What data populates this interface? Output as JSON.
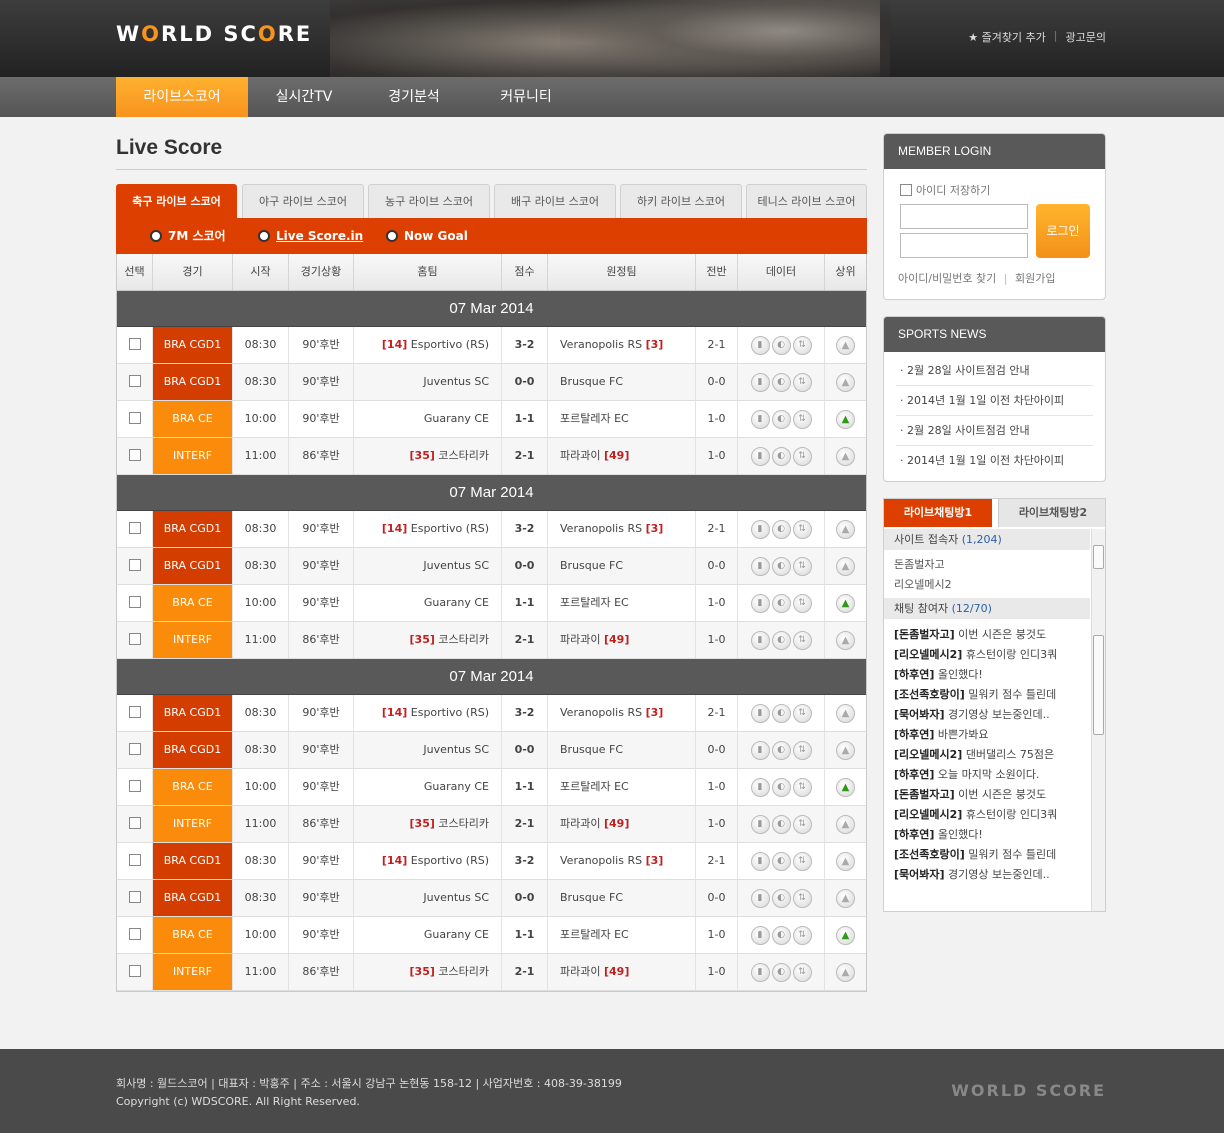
{
  "brand": {
    "logo_part1": "W",
    "logo_o": "O",
    "logo_part2": "RLD SC",
    "logo_o2": "O",
    "logo_part3": "RE"
  },
  "toplinks": {
    "bookmark": "★ 즐겨찾기 추가",
    "sep": "|",
    "ad": "광고문의"
  },
  "gnb": [
    "라이브스코어",
    "실시간TV",
    "경기분석",
    "커뮤니티"
  ],
  "page_title": "Live Score",
  "sport_tabs": [
    "축구 라이브 스코어",
    "야구 라이브 스코어",
    "농구 라이브 스코어",
    "배구 라이브 스코어",
    "하키 라이브 스코어",
    "테니스 라이브 스코어"
  ],
  "sub_links": [
    "7M 스코어",
    "Live Score.in",
    "Now Goal"
  ],
  "columns": [
    "선택",
    "경기",
    "시작",
    "경기상황",
    "홈팀",
    "점수",
    "원정팀",
    "전반",
    "데이터",
    "상위"
  ],
  "groups": [
    {
      "date": "07 Mar 2014",
      "rows": [
        {
          "league": "BRA CGD1",
          "color": "red",
          "start": "08:30",
          "status": "90'후반",
          "home_rank": "[14]",
          "home": "Esportivo (RS)",
          "score": "3-2",
          "away": "Veranopolis RS",
          "away_rank": "[3]",
          "half": "2-1",
          "up": "gray"
        },
        {
          "league": "BRA CGD1",
          "color": "red",
          "start": "08:30",
          "status": "90'후반",
          "home_rank": "",
          "home": "Juventus SC",
          "score": "0-0",
          "away": "Brusque FC",
          "away_rank": "",
          "half": "0-0",
          "up": "gray"
        },
        {
          "league": "BRA CE",
          "color": "orange",
          "start": "10:00",
          "status": "90'후반",
          "home_rank": "",
          "home": "Guarany CE",
          "score": "1-1",
          "away": "포르탈레자 EC",
          "away_rank": "",
          "half": "1-0",
          "up": "green"
        },
        {
          "league": "INTERF",
          "color": "orange",
          "start": "11:00",
          "status": "86'후반",
          "home_rank": "[35]",
          "home": "코스타리카",
          "score": "2-1",
          "away": "파라과이",
          "away_rank": "[49]",
          "half": "1-0",
          "up": "gray"
        }
      ]
    },
    {
      "date": "07 Mar 2014",
      "rows": [
        {
          "league": "BRA CGD1",
          "color": "red",
          "start": "08:30",
          "status": "90'후반",
          "home_rank": "[14]",
          "home": "Esportivo (RS)",
          "score": "3-2",
          "away": "Veranopolis RS",
          "away_rank": "[3]",
          "half": "2-1",
          "up": "gray"
        },
        {
          "league": "BRA CGD1",
          "color": "red",
          "start": "08:30",
          "status": "90'후반",
          "home_rank": "",
          "home": "Juventus SC",
          "score": "0-0",
          "away": "Brusque FC",
          "away_rank": "",
          "half": "0-0",
          "up": "gray"
        },
        {
          "league": "BRA CE",
          "color": "orange",
          "start": "10:00",
          "status": "90'후반",
          "home_rank": "",
          "home": "Guarany CE",
          "score": "1-1",
          "away": "포르탈레자 EC",
          "away_rank": "",
          "half": "1-0",
          "up": "green"
        },
        {
          "league": "INTERF",
          "color": "orange",
          "start": "11:00",
          "status": "86'후반",
          "home_rank": "[35]",
          "home": "코스타리카",
          "score": "2-1",
          "away": "파라과이",
          "away_rank": "[49]",
          "half": "1-0",
          "up": "gray"
        }
      ]
    },
    {
      "date": "07 Mar 2014",
      "rows": [
        {
          "league": "BRA CGD1",
          "color": "red",
          "start": "08:30",
          "status": "90'후반",
          "home_rank": "[14]",
          "home": "Esportivo (RS)",
          "score": "3-2",
          "away": "Veranopolis RS",
          "away_rank": "[3]",
          "half": "2-1",
          "up": "gray"
        },
        {
          "league": "BRA CGD1",
          "color": "red",
          "start": "08:30",
          "status": "90'후반",
          "home_rank": "",
          "home": "Juventus SC",
          "score": "0-0",
          "away": "Brusque FC",
          "away_rank": "",
          "half": "0-0",
          "up": "gray"
        },
        {
          "league": "BRA CE",
          "color": "orange",
          "start": "10:00",
          "status": "90'후반",
          "home_rank": "",
          "home": "Guarany CE",
          "score": "1-1",
          "away": "포르탈레자 EC",
          "away_rank": "",
          "half": "1-0",
          "up": "green"
        },
        {
          "league": "INTERF",
          "color": "orange",
          "start": "11:00",
          "status": "86'후반",
          "home_rank": "[35]",
          "home": "코스타리카",
          "score": "2-1",
          "away": "파라과이",
          "away_rank": "[49]",
          "half": "1-0",
          "up": "gray"
        },
        {
          "league": "BRA CGD1",
          "color": "red",
          "start": "08:30",
          "status": "90'후반",
          "home_rank": "[14]",
          "home": "Esportivo (RS)",
          "score": "3-2",
          "away": "Veranopolis RS",
          "away_rank": "[3]",
          "half": "2-1",
          "up": "gray"
        },
        {
          "league": "BRA CGD1",
          "color": "red",
          "start": "08:30",
          "status": "90'후반",
          "home_rank": "",
          "home": "Juventus SC",
          "score": "0-0",
          "away": "Brusque FC",
          "away_rank": "",
          "half": "0-0",
          "up": "gray"
        },
        {
          "league": "BRA CE",
          "color": "orange",
          "start": "10:00",
          "status": "90'후반",
          "home_rank": "",
          "home": "Guarany CE",
          "score": "1-1",
          "away": "포르탈레자 EC",
          "away_rank": "",
          "half": "1-0",
          "up": "green"
        },
        {
          "league": "INTERF",
          "color": "orange",
          "start": "11:00",
          "status": "86'후반",
          "home_rank": "[35]",
          "home": "코스타리카",
          "score": "2-1",
          "away": "파라과이",
          "away_rank": "[49]",
          "half": "1-0",
          "up": "gray"
        }
      ]
    }
  ],
  "colors": {
    "accent": "#dd3f00",
    "orange": "#f7941d",
    "league_red": "#d33d00",
    "league_orange": "#fb8c0b",
    "up_green": "#2f9a1a"
  },
  "login": {
    "title": "MEMBER LOGIN",
    "save_id": "아이디 저장하기",
    "button": "로그인",
    "find": "아이디/비밀번호 찾기",
    "sep": "|",
    "join": "회원가입"
  },
  "news": {
    "title": "SPORTS NEWS",
    "items": [
      "· 2월 28일 사이트점검 안내",
      "· 2014년 1월 1일 이전 차단아이피",
      "· 2월 28일 사이트점검 안내",
      "· 2014년 1월 1일 이전 차단아이피"
    ]
  },
  "chat": {
    "tab1": "라이브채팅방1",
    "tab2": "라이브채팅방2",
    "visitors_label": "사이트 접속자",
    "visitors_count": "(1,204)",
    "users": [
      "돈좀벌자고",
      "리오넬메시2"
    ],
    "participants_label": "채팅 참여자",
    "participants_count": "(12/70)",
    "lines": [
      {
        "user": "[돈좀벌자고]",
        "msg": "이번 시즌은 붕것도"
      },
      {
        "user": "[리오넬메시2]",
        "msg": "휴스턴이랑 인디3쿼"
      },
      {
        "user": "[하후연]",
        "msg": "올인했다!"
      },
      {
        "user": "[조선족호랑이]",
        "msg": "밀워키 점수 틀린데"
      },
      {
        "user": "[묵어봐자]",
        "msg": "경기영상 보는중인데.."
      },
      {
        "user": "[하후연]",
        "msg": "바쁜가봐요"
      },
      {
        "user": "[리오넬메시2]",
        "msg": "댄버댈리스 75점은"
      },
      {
        "user": "[하후연]",
        "msg": "오늘 마지막 소원이다."
      },
      {
        "user": "[돈좀벌자고]",
        "msg": "이번 시즌은 붕것도"
      },
      {
        "user": "[리오넬메시2]",
        "msg": "휴스턴이랑 인디3쿼"
      },
      {
        "user": "[하후연]",
        "msg": "올인했다!"
      },
      {
        "user": "[조선족호랑이]",
        "msg": "밀워키 점수 틀린데"
      },
      {
        "user": "[묵어봐자]",
        "msg": "경기영상 보는중인데.."
      }
    ]
  },
  "footer": {
    "line1": "회사명 : 월드스코어  |  대표자 : 박홍주  |  주소 : 서울시 강남구 논현동 158-12  |  사업자번호 : 408-39-38199",
    "line2": "Copyright (c) WDSCORE. All Right Reserved.",
    "logo": "WORLD SCORE"
  }
}
